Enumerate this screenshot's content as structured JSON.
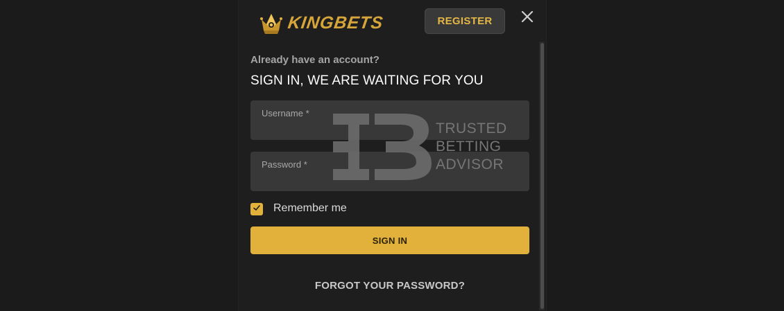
{
  "header": {
    "logo_text": "KINGBETS",
    "register_label": "REGISTER"
  },
  "form": {
    "subtitle": "Already have an account?",
    "heading": "SIGN IN, WE ARE WAITING FOR YOU",
    "username_label": "Username *",
    "username_value": "",
    "password_label": "Password *",
    "password_value": "",
    "remember_label": "Remember me",
    "remember_checked": true,
    "signin_label": "SIGN IN",
    "forgot_label": "FORGOT YOUR PASSWORD?"
  },
  "watermark": {
    "line1": "TRUSTED",
    "line2": "BETTING",
    "line3": "ADVISOR"
  },
  "colors": {
    "accent": "#e1b13b",
    "background": "#1c1b1c",
    "field": "#393839"
  },
  "icons": {
    "logo": "crown-icon",
    "close": "close-icon",
    "checkbox": "checkmark-icon"
  }
}
